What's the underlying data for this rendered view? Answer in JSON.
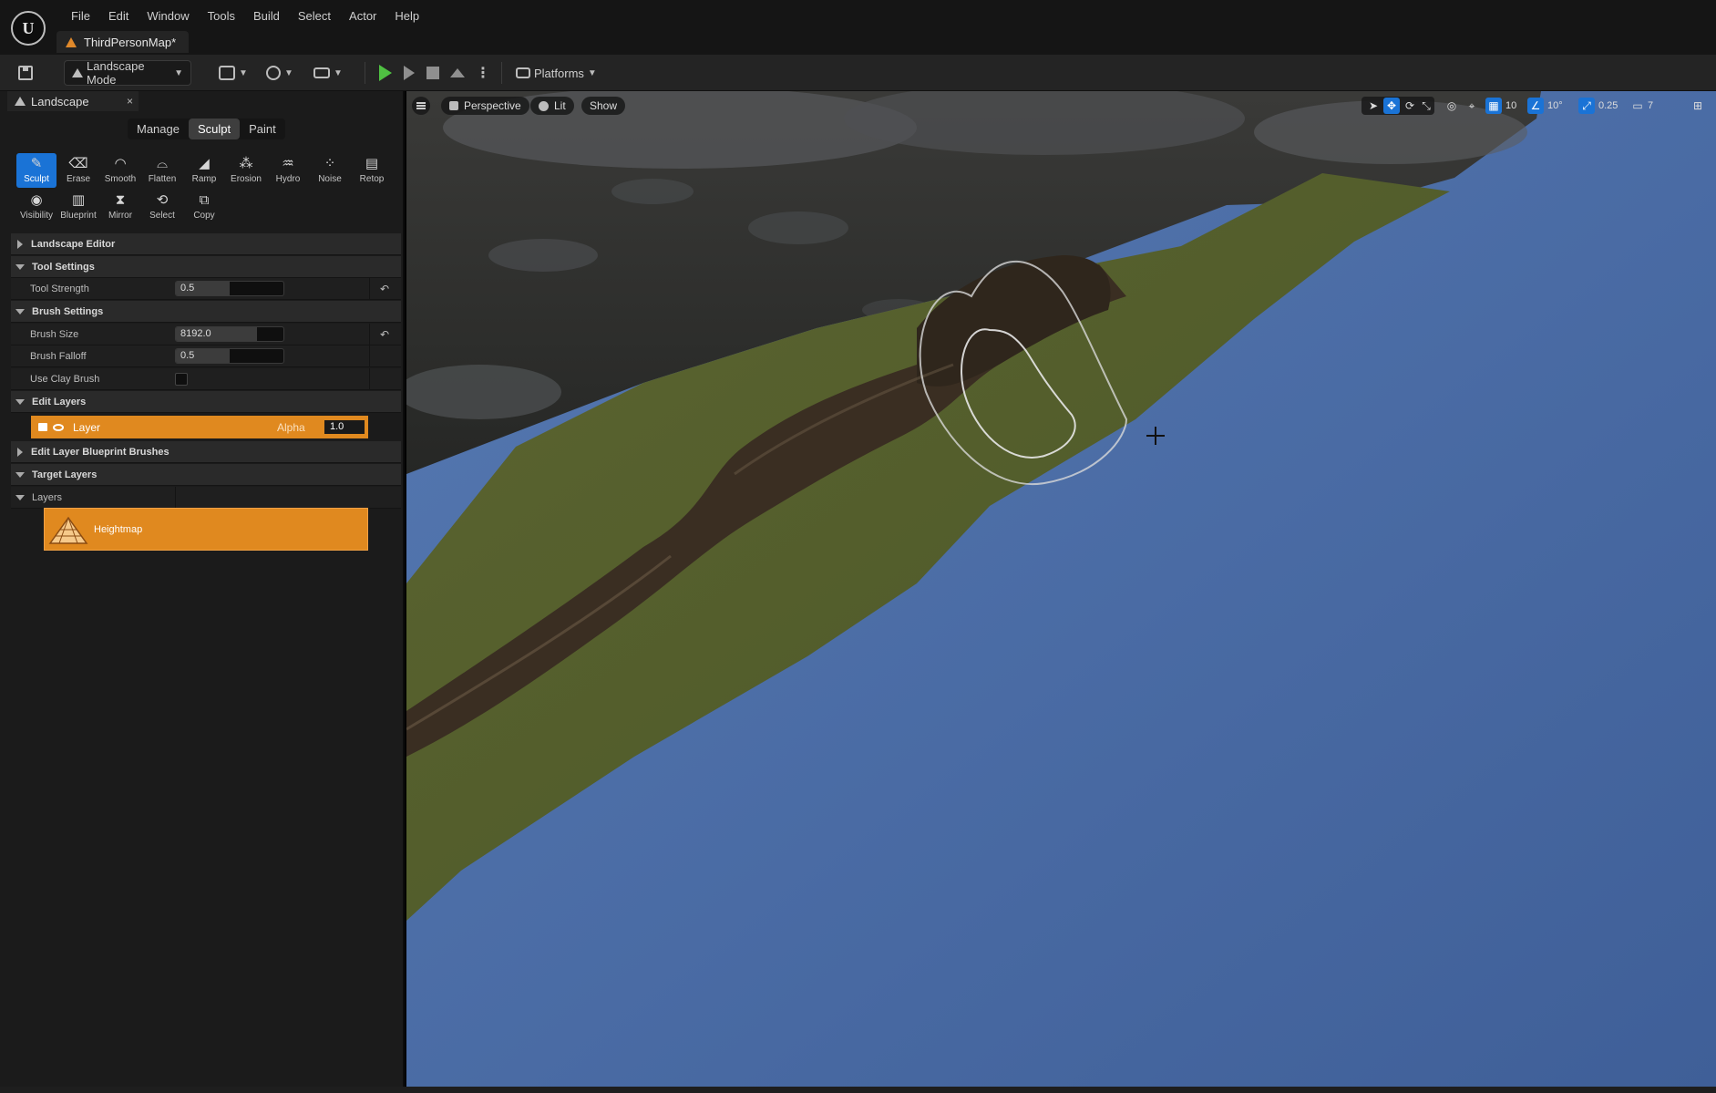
{
  "app": {
    "logo_text": "U",
    "menu": [
      "File",
      "Edit",
      "Window",
      "Tools",
      "Build",
      "Select",
      "Actor",
      "Help"
    ],
    "map_tab": "ThirdPersonMap*"
  },
  "toolbar": {
    "mode_label": "Landscape Mode",
    "platforms_label": "Platforms"
  },
  "panel": {
    "tab_label": "Landscape",
    "close_glyph": "×",
    "mode_tabs": [
      {
        "label": "Manage",
        "active": false
      },
      {
        "label": "Sculpt",
        "active": true
      },
      {
        "label": "Paint",
        "active": false
      }
    ],
    "tools_row1": [
      {
        "label": "Sculpt",
        "glyph": "✎",
        "active": true
      },
      {
        "label": "Erase",
        "glyph": "⌫",
        "active": false
      },
      {
        "label": "Smooth",
        "glyph": "◠",
        "active": false
      },
      {
        "label": "Flatten",
        "glyph": "⌓",
        "active": false
      },
      {
        "label": "Ramp",
        "glyph": "◢",
        "active": false
      },
      {
        "label": "Erosion",
        "glyph": "⁂",
        "active": false
      },
      {
        "label": "Hydro",
        "glyph": "♒",
        "active": false
      },
      {
        "label": "Noise",
        "glyph": "⁘",
        "active": false
      },
      {
        "label": "Retop",
        "glyph": "▤",
        "active": false
      }
    ],
    "tools_row2": [
      {
        "label": "Visibility",
        "glyph": "◉",
        "active": false
      },
      {
        "label": "Blueprint",
        "glyph": "▥",
        "active": false
      },
      {
        "label": "Mirror",
        "glyph": "⧗",
        "active": false
      },
      {
        "label": "Select",
        "glyph": "⟲",
        "active": false
      },
      {
        "label": "Copy",
        "glyph": "⧉",
        "active": false
      }
    ],
    "sections": {
      "landscape_editor": "Landscape Editor",
      "tool_settings": "Tool Settings",
      "tool_strength_label": "Tool Strength",
      "tool_strength_value": "0.5",
      "tool_strength_fraction": 0.5,
      "brush_settings": "Brush Settings",
      "brush_size_label": "Brush Size",
      "brush_size_value": "8192.0",
      "brush_size_fraction": 0.75,
      "brush_falloff_label": "Brush Falloff",
      "brush_falloff_value": "0.5",
      "brush_falloff_fraction": 0.5,
      "use_clay_label": "Use Clay Brush",
      "use_clay_checked": false,
      "edit_layers": "Edit Layers",
      "layer_label": "Layer",
      "alpha_label": "Alpha",
      "alpha_value": "1.0",
      "edit_layer_bp": "Edit Layer Blueprint Brushes",
      "target_layers": "Target Layers",
      "layers": "Layers",
      "heightmap_label": "Heightmap"
    }
  },
  "viewport": {
    "perspective_label": "Perspective",
    "lit_label": "Lit",
    "show_label": "Show",
    "grid_snap": "10",
    "rot_snap": "10°",
    "scale_snap": "0.25",
    "camera_speed": "7"
  },
  "colors": {
    "accent_orange": "#e0891f",
    "accent_blue": "#1a73d6",
    "water": "#4b6da8",
    "grass": "#59612e",
    "rock": "#2e2e2b"
  }
}
